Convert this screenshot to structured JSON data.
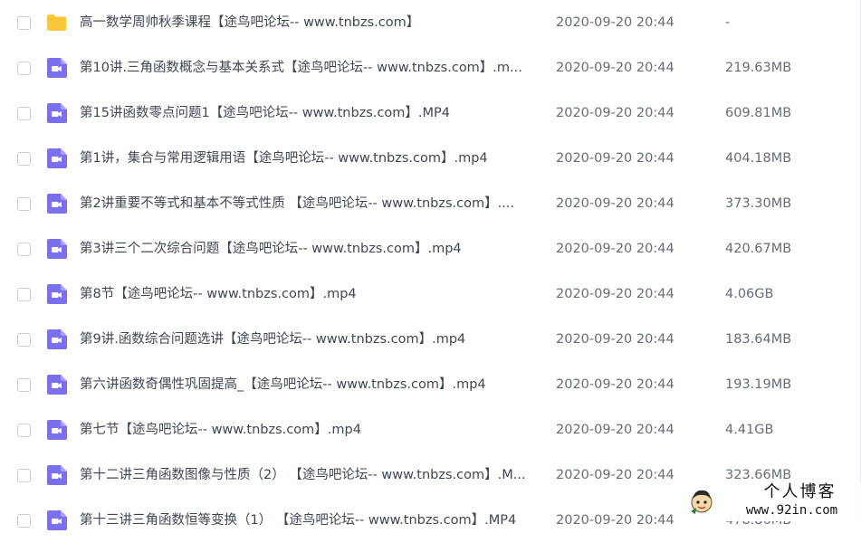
{
  "files": [
    {
      "type": "folder",
      "name": "高一数学周帅秋季课程【途鸟吧论坛-- www.tnbzs.com】",
      "date": "2020-09-20 20:44",
      "size": "-"
    },
    {
      "type": "video",
      "name": "第10讲.三角函数概念与基本关系式【途鸟吧论坛-- www.tnbzs.com】.m...",
      "date": "2020-09-20 20:44",
      "size": "219.63MB"
    },
    {
      "type": "video",
      "name": "第15讲函数零点问题1【途鸟吧论坛-- www.tnbzs.com】.MP4",
      "date": "2020-09-20 20:44",
      "size": "609.81MB"
    },
    {
      "type": "video",
      "name": "第1讲，集合与常用逻辑用语【途鸟吧论坛-- www.tnbzs.com】.mp4",
      "date": "2020-09-20 20:44",
      "size": "404.18MB"
    },
    {
      "type": "video",
      "name": "第2讲重要不等式和基本不等式性质 【途鸟吧论坛-- www.tnbzs.com】....",
      "date": "2020-09-20 20:44",
      "size": "373.30MB"
    },
    {
      "type": "video",
      "name": "第3讲三个二次综合问题【途鸟吧论坛-- www.tnbzs.com】.mp4",
      "date": "2020-09-20 20:44",
      "size": "420.67MB"
    },
    {
      "type": "video",
      "name": "第8节【途鸟吧论坛-- www.tnbzs.com】.mp4",
      "date": "2020-09-20 20:44",
      "size": "4.06GB"
    },
    {
      "type": "video",
      "name": "第9讲.函数综合问题选讲【途鸟吧论坛-- www.tnbzs.com】.mp4",
      "date": "2020-09-20 20:44",
      "size": "183.64MB"
    },
    {
      "type": "video",
      "name": "第六讲函数奇偶性巩固提高_【途鸟吧论坛-- www.tnbzs.com】.mp4",
      "date": "2020-09-20 20:44",
      "size": "193.19MB"
    },
    {
      "type": "video",
      "name": "第七节【途鸟吧论坛-- www.tnbzs.com】.mp4",
      "date": "2020-09-20 20:44",
      "size": "4.41GB"
    },
    {
      "type": "video",
      "name": "第十二讲三角函数图像与性质（2） 【途鸟吧论坛-- www.tnbzs.com】.M...",
      "date": "2020-09-20 20:44",
      "size": "323.66MB"
    },
    {
      "type": "video",
      "name": "第十三讲三角函数恒等变换（1） 【途鸟吧论坛-- www.tnbzs.com】.MP4",
      "date": "2020-09-20 20:44",
      "size": "478.86MB"
    }
  ],
  "watermark": {
    "line1": "个人博客",
    "line2": "www.92in.com"
  },
  "colors": {
    "folder": "#f9c93c",
    "video": "#7b6ff0",
    "checkbox_border": "#c9ced6"
  }
}
